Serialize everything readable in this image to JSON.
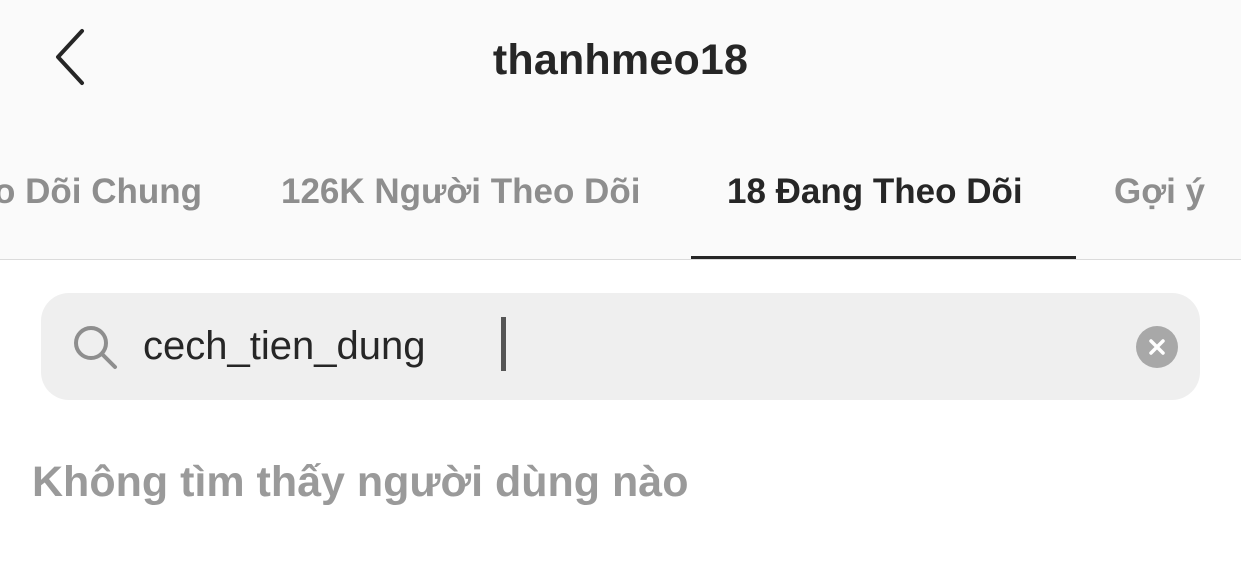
{
  "header": {
    "back_icon": "chevron-left-icon",
    "title": "thanhmeo18"
  },
  "tabs": [
    {
      "label": "o Dõi Chung",
      "active": false
    },
    {
      "label": "126K Người Theo Dõi",
      "active": false
    },
    {
      "label": "18 Đang Theo Dõi",
      "active": true
    },
    {
      "label": "Gợi ý",
      "active": false
    }
  ],
  "search": {
    "icon": "search-icon",
    "value": "cech_tien_dung",
    "clear_icon": "clear-icon"
  },
  "results": {
    "empty_message": "Không tìm thấy người dùng nào"
  },
  "colors": {
    "header_background": "#fafafa",
    "search_background": "#efefef",
    "active_text": "#262626",
    "inactive_text": "#8e8e8e"
  }
}
